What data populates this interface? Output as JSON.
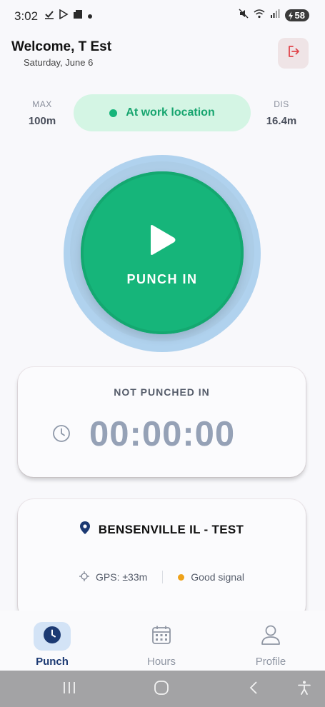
{
  "status_bar": {
    "time": "3:02",
    "battery": "58",
    "icons_left": [
      "check-icon",
      "play-store-icon",
      "clipboard-icon",
      "dot-icon"
    ],
    "icons_right": [
      "mute-icon",
      "wifi-icon",
      "signal-icon",
      "battery-icon"
    ]
  },
  "header": {
    "welcome": "Welcome, T Est",
    "date": "Saturday, June 6",
    "logout_icon": "logout-icon"
  },
  "location_status": {
    "max_label": "MAX",
    "max_value": "100m",
    "status_text": "At work location",
    "dis_label": "DIS",
    "dis_value": "16.4m"
  },
  "punch": {
    "label": "PUNCH IN",
    "icon": "play-icon"
  },
  "timer": {
    "status": "NOT PUNCHED IN",
    "value": "00:00:00",
    "icon": "clock-icon"
  },
  "site": {
    "name": "BENSENVILLE IL - TEST",
    "gps": "GPS: ±33m",
    "signal": "Good signal"
  },
  "bottom_nav": {
    "items": [
      {
        "label": "Punch",
        "icon": "clock-icon",
        "active": true
      },
      {
        "label": "Hours",
        "icon": "calendar-icon",
        "active": false
      },
      {
        "label": "Profile",
        "icon": "person-icon",
        "active": false
      }
    ]
  },
  "colors": {
    "accent_green": "#16b57a",
    "nav_active": "#1c3a73",
    "signal_dot": "#eea21a",
    "logout": "#e0454b"
  }
}
